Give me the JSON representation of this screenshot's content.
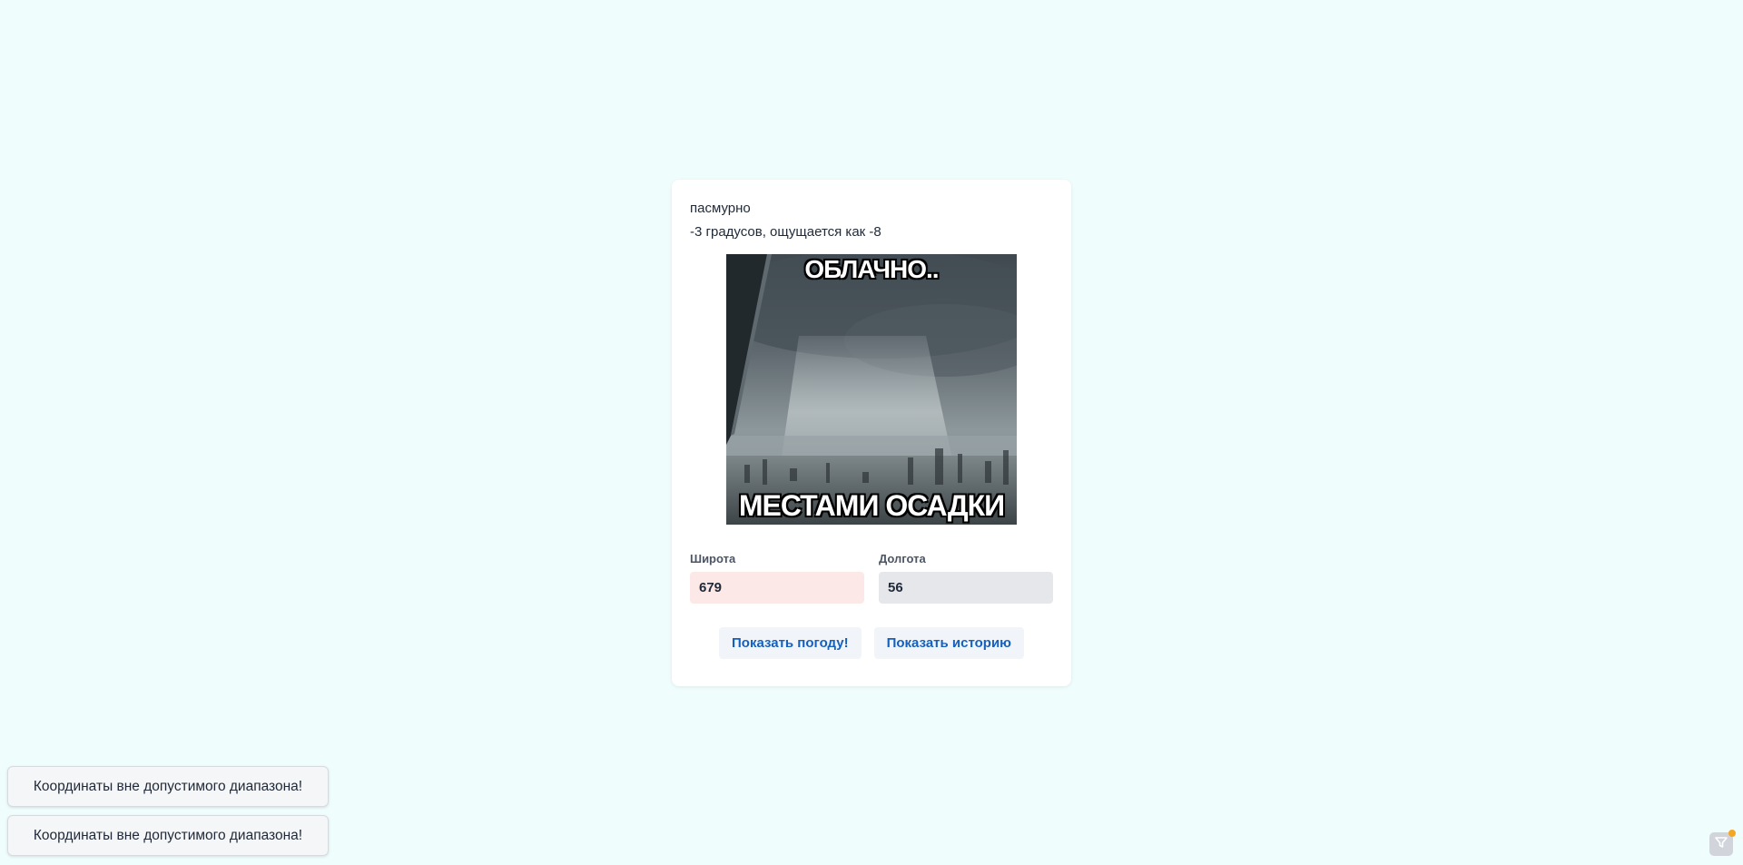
{
  "weather": {
    "condition": "пасмурно",
    "temperature_text": "-3 градусов, ощущается как -8",
    "image": {
      "top_text": "ОБЛАЧНО..",
      "bottom_text": "МЕСТАМИ ОСАДКИ"
    }
  },
  "form": {
    "latitude": {
      "label": "Широта",
      "value": "679",
      "bg_color": "#fde8e8"
    },
    "longitude": {
      "label": "Долгота",
      "value": "56",
      "bg_color": "#e5e7eb"
    }
  },
  "actions": {
    "show_weather_label": "Показать погоду!",
    "show_history_label": "Показать историю"
  },
  "toasts": [
    {
      "message": "Координаты вне допустимого диапазона!"
    },
    {
      "message": "Координаты вне допустимого диапазона!"
    }
  ],
  "colors": {
    "background": "#f0fdfd",
    "accent": "#1560bd",
    "notification_dot": "#f5a623"
  },
  "icons": {
    "corner_widget": "filter-icon"
  }
}
